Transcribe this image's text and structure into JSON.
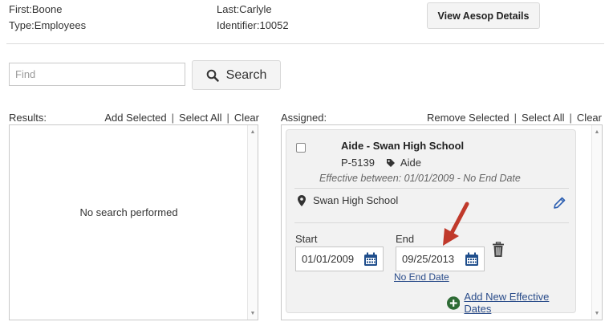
{
  "header": {
    "first": "First:Boone",
    "last": "Last:Carlyle",
    "type": "Type:Employees",
    "identifier": "Identifier:10052",
    "view_button": "View Aesop Details"
  },
  "find": {
    "placeholder": "Find",
    "value": ""
  },
  "search_button": "Search",
  "results": {
    "label": "Results:",
    "add_selected": "Add Selected",
    "select_all": "Select All",
    "clear": "Clear",
    "empty_message": "No search performed"
  },
  "assigned": {
    "label": "Assigned:",
    "remove_selected": "Remove Selected",
    "select_all": "Select All",
    "clear": "Clear",
    "card": {
      "title": "Aide - Swan High School",
      "position_code": "P-5139",
      "tag": "Aide",
      "effective": "Effective between: 01/01/2009 - No End Date",
      "location": "Swan High School",
      "start_label": "Start",
      "start_value": "01/01/2009",
      "end_label": "End",
      "end_value": "09/25/2013",
      "no_end_date": "No End Date",
      "add_new_dates": "Add New Effective Dates"
    }
  },
  "colors": {
    "link": "#2a4c8a",
    "calendar_icon": "#1f4e8c",
    "add_icon": "#2e6b35",
    "annotation_arrow": "#c0392b"
  }
}
